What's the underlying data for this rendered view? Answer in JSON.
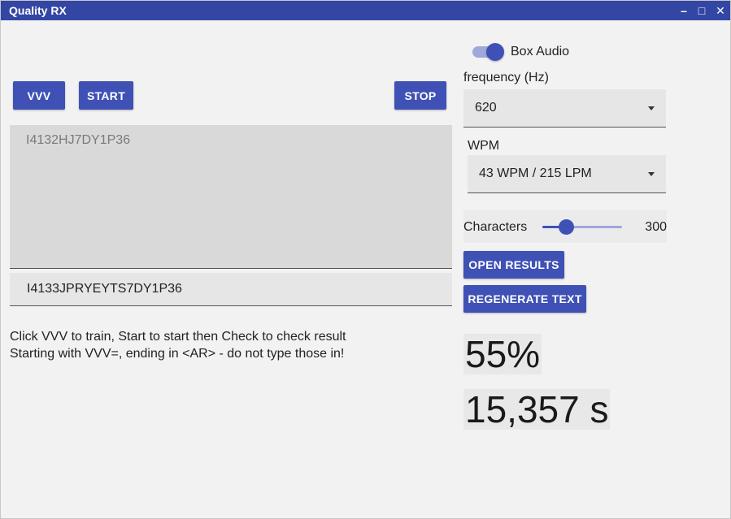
{
  "window": {
    "title": "Quality RX",
    "controls": {
      "minimize": "–",
      "maximize": "□",
      "close": "✕"
    },
    "titlebar_color": "#3446a4"
  },
  "toolbar": {
    "vvv_label": "VVV",
    "start_label": "START",
    "stop_label": "STOP"
  },
  "sent_text": "I4132HJ7DY1P36",
  "answer_input": {
    "value": "I4133JPRYEYTS7DY1P36"
  },
  "instructions": [
    "Click VVV to train, Start to start then Check to check result",
    "Starting with VVV=, ending in <AR> - do not type those in!"
  ],
  "settings": {
    "box_audio": {
      "label": "Box Audio",
      "on": true
    },
    "frequency": {
      "label": "frequency (Hz)",
      "value": "620"
    },
    "wpm": {
      "label": "WPM",
      "value": "43 WPM / 215 LPM"
    },
    "characters": {
      "label": "Characters",
      "value": "300",
      "fraction": 0.3
    },
    "open_results_label": "OPEN RESULTS",
    "regenerate_label": "REGENERATE TEXT"
  },
  "stats": {
    "score": "55%",
    "time": "15,357 s"
  },
  "colors": {
    "accent": "#3f51b5",
    "accent_light": "#9fa8da"
  },
  "icons": {
    "caret": "dropdown-caret-icon"
  }
}
